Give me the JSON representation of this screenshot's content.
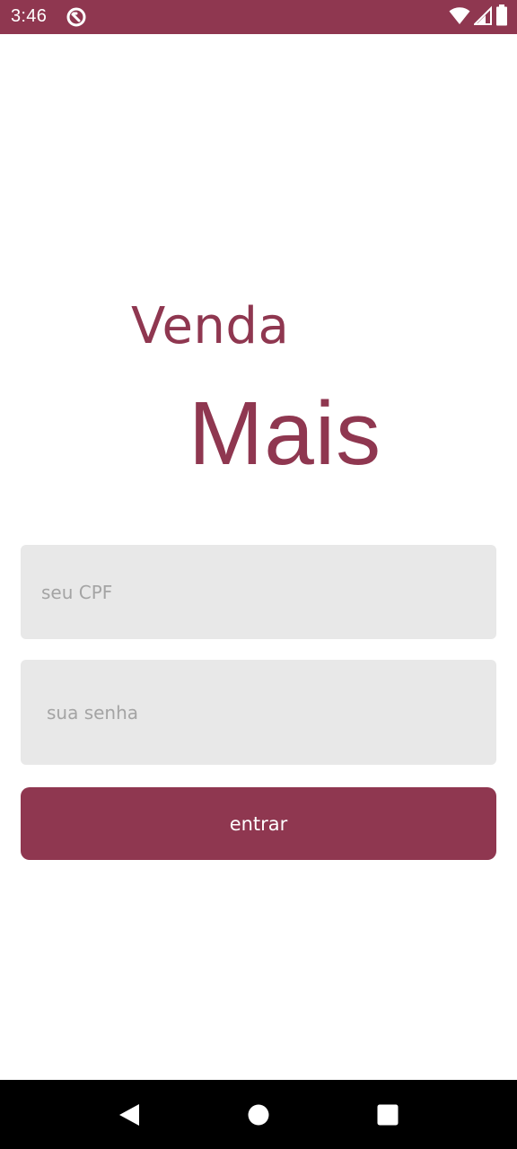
{
  "status_bar": {
    "time": "3:46",
    "background": "#8f3750",
    "icons": [
      "app-notification-icon",
      "wifi-icon",
      "cell-signal-icon",
      "battery-icon"
    ]
  },
  "logo": {
    "line1": "Venda",
    "line2": "Mais",
    "color": "#8f3750"
  },
  "form": {
    "cpf_placeholder": "seu CPF",
    "cpf_value": "",
    "password_placeholder": "sua senha",
    "password_value": "",
    "submit_label": "entrar",
    "field_background": "#e8e8e8",
    "button_color": "#8f3750"
  },
  "nav_bar": {
    "buttons": [
      "back-icon",
      "home-icon",
      "recent-apps-icon"
    ]
  }
}
